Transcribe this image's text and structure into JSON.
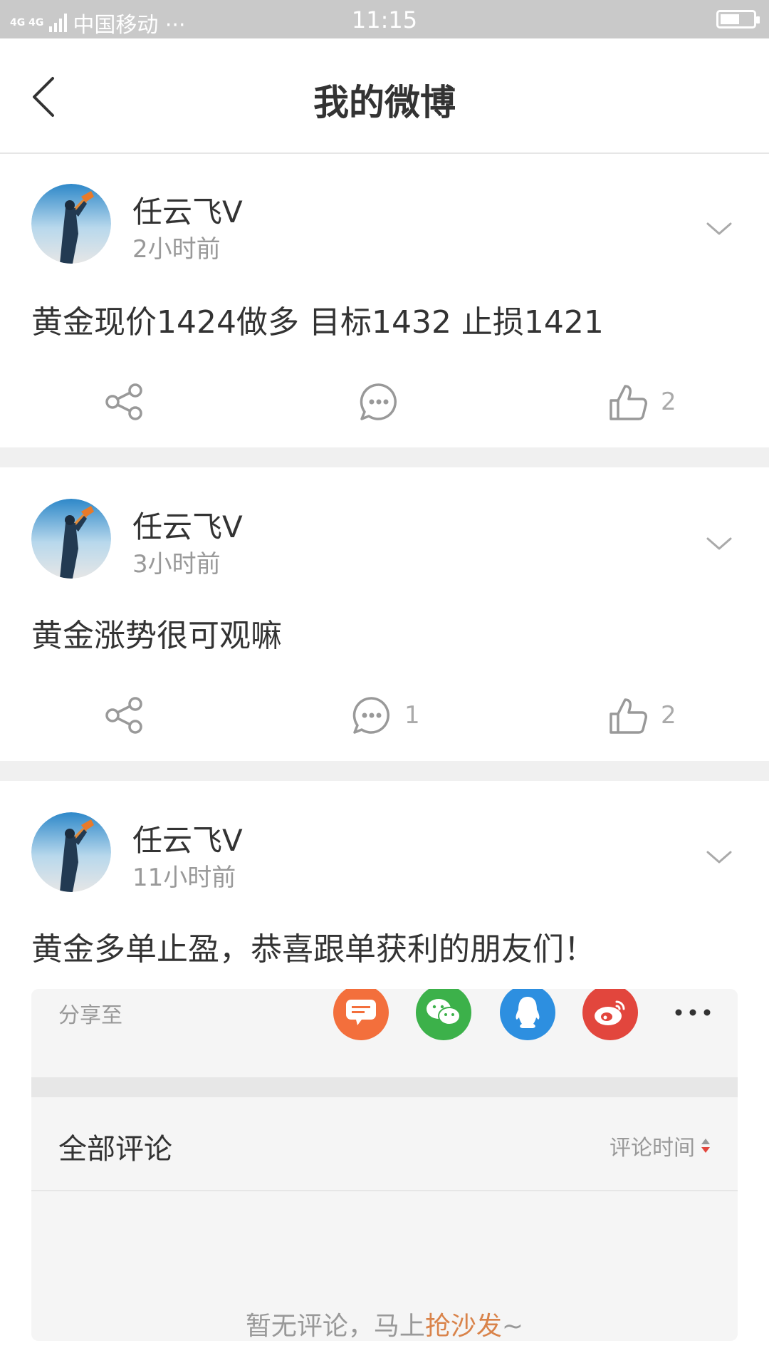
{
  "status_bar": {
    "network": "4G 4G",
    "carrier": "中国移动 ···",
    "time": "11:15",
    "battery_level": 0.6
  },
  "header": {
    "title": "我的微博"
  },
  "posts": [
    {
      "author": "任云飞V",
      "time": "2小时前",
      "content": "黄金现价1424做多 目标1432 止损1421",
      "comments": "",
      "likes": "2"
    },
    {
      "author": "任云飞V",
      "time": "3小时前",
      "content": "黄金涨势很可观嘛",
      "comments": "1",
      "likes": "2"
    },
    {
      "author": "任云飞V",
      "time": "11小时前",
      "content": "黄金多单止盈，恭喜跟单获利的朋友们！"
    }
  ],
  "share_sheet": {
    "label": "分享至",
    "targets": [
      "message-icon",
      "wechat-icon",
      "qq-icon",
      "weibo-icon",
      "more-icon"
    ],
    "colors": {
      "message": "#f36f3c",
      "wechat": "#3cb14a",
      "qq": "#2d8fe0",
      "weibo": "#e2463d"
    }
  },
  "comments": {
    "title": "全部评论",
    "sort_label": "评论时间",
    "empty_prefix": "暂无评论，马上",
    "empty_link": "抢沙发",
    "empty_suffix": "~"
  },
  "colors": {
    "status_bar": "#c9c9c9",
    "separator": "#f0f0f0",
    "accent": "#d9834a",
    "text": "#333333",
    "muted": "#999999"
  }
}
